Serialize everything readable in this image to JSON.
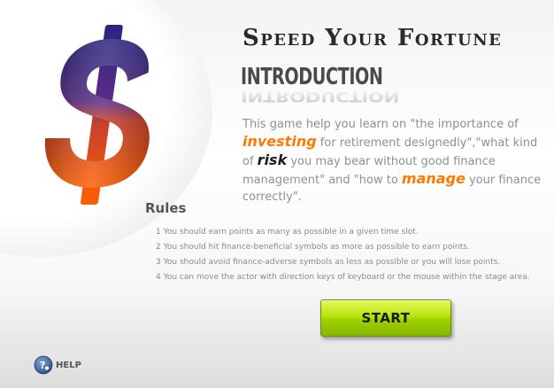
{
  "game": {
    "title": "Speed Your Fortune"
  },
  "intro": {
    "heading": "INTRODUCTION",
    "segments": [
      {
        "text": "This game help you learn on \"the importance of ",
        "style": "plain"
      },
      {
        "text": "investing",
        "style": "orange"
      },
      {
        "text": " for retirement designedly\",\"what kind of ",
        "style": "plain"
      },
      {
        "text": "risk",
        "style": "dark"
      },
      {
        "text": " you may bear without good finance management\" and \"how to ",
        "style": "plain"
      },
      {
        "text": "manage",
        "style": "orange"
      },
      {
        "text": " your finance correctly\".",
        "style": "plain"
      }
    ]
  },
  "rules": {
    "title": "Rules",
    "items": [
      "1 You should earn points as many as possible in a given time slot.",
      "2 You should hit finance-beneficial symbols as more as possible to earn points.",
      "3 You should avoid finance-adverse symbols as less as possible or you will lose points.",
      "4 You can move the actor with direction keys of keyboard or the mouse within the stage area."
    ]
  },
  "buttons": {
    "start_label": "START",
    "help_label": "HELP"
  },
  "icons": {
    "logo": "dollar-sign-icon",
    "help": "help-question-icon"
  },
  "colors": {
    "accent_orange": "#ff7a00",
    "start_green": "#a8d800",
    "dollar_top": "#3a2a8c",
    "dollar_bottom": "#ff5a00"
  }
}
